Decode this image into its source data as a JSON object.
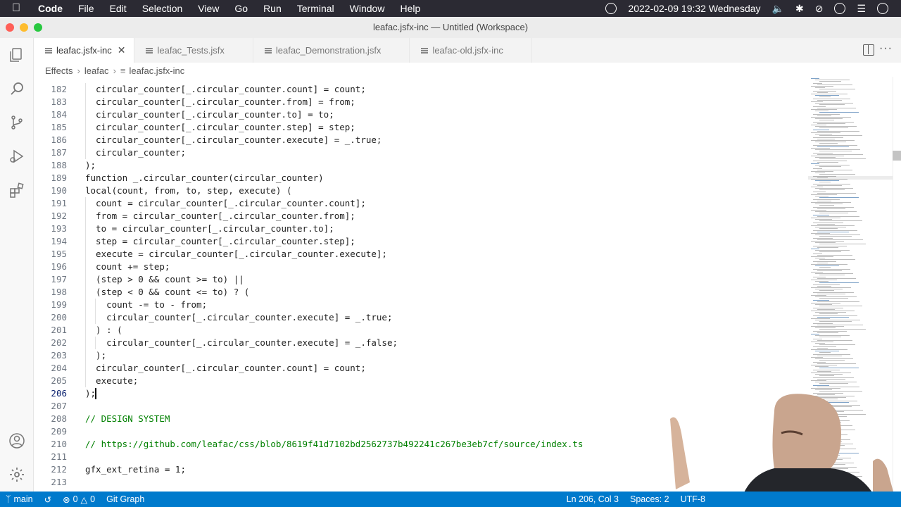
{
  "menubar": {
    "app_name": "Code",
    "items": [
      "File",
      "Edit",
      "Selection",
      "View",
      "Go",
      "Run",
      "Terminal",
      "Window",
      "Help"
    ],
    "clock": "2022-02-09  19:32  Wednesday"
  },
  "window": {
    "title": "leafac.jsfx-inc — Untitled (Workspace)"
  },
  "tabs": [
    {
      "label": "leafac.jsfx-inc",
      "active": true
    },
    {
      "label": "leafac_Tests.jsfx"
    },
    {
      "label": "leafac_Demonstration.jsfx"
    },
    {
      "label": "leafac-old.jsfx-inc"
    }
  ],
  "breadcrumb": [
    "Effects",
    "leafac",
    "leafac.jsfx-inc"
  ],
  "editor": {
    "current_line": "206",
    "lines": [
      {
        "n": "182",
        "t": "  circular_counter[_.circular_counter.count] = count;"
      },
      {
        "n": "183",
        "t": "  circular_counter[_.circular_counter.from] = from;"
      },
      {
        "n": "184",
        "t": "  circular_counter[_.circular_counter.to] = to;"
      },
      {
        "n": "185",
        "t": "  circular_counter[_.circular_counter.step] = step;"
      },
      {
        "n": "186",
        "t": "  circular_counter[_.circular_counter.execute] = _.true;"
      },
      {
        "n": "187",
        "t": "  circular_counter;"
      },
      {
        "n": "188",
        "t": ");"
      },
      {
        "n": "189",
        "t": "function _.circular_counter(circular_counter)"
      },
      {
        "n": "190",
        "t": "local(count, from, to, step, execute) ("
      },
      {
        "n": "191",
        "t": "  count = circular_counter[_.circular_counter.count];"
      },
      {
        "n": "192",
        "t": "  from = circular_counter[_.circular_counter.from];"
      },
      {
        "n": "193",
        "t": "  to = circular_counter[_.circular_counter.to];"
      },
      {
        "n": "194",
        "t": "  step = circular_counter[_.circular_counter.step];"
      },
      {
        "n": "195",
        "t": "  execute = circular_counter[_.circular_counter.execute];"
      },
      {
        "n": "196",
        "t": "  count += step;"
      },
      {
        "n": "197",
        "t": "  (step > 0 && count >= to) ||"
      },
      {
        "n": "198",
        "t": "  (step < 0 && count <= to) ? ("
      },
      {
        "n": "199",
        "t": "    count -= to - from;"
      },
      {
        "n": "200",
        "t": "    circular_counter[_.circular_counter.execute] = _.true;"
      },
      {
        "n": "201",
        "t": "  ) : ("
      },
      {
        "n": "202",
        "t": "    circular_counter[_.circular_counter.execute] = _.false;"
      },
      {
        "n": "203",
        "t": "  );"
      },
      {
        "n": "204",
        "t": "  circular_counter[_.circular_counter.count] = count;"
      },
      {
        "n": "205",
        "t": "  execute;"
      },
      {
        "n": "206",
        "t": ");"
      },
      {
        "n": "207",
        "t": ""
      },
      {
        "n": "208",
        "t": "// DESIGN SYSTEM"
      },
      {
        "n": "209",
        "t": ""
      },
      {
        "n": "210",
        "t": "// https://github.com/leafac/css/blob/8619f41d7102bd2562737b492241c267be3eb7cf/source/index.ts"
      },
      {
        "n": "211",
        "t": ""
      },
      {
        "n": "212",
        "t": "gfx_ext_retina = 1;"
      },
      {
        "n": "213",
        "t": ""
      }
    ]
  },
  "statusbar": {
    "branch": "main",
    "errors": "0",
    "warnings": "0",
    "git_graph": "Git Graph",
    "position": "Ln 206, Col 3",
    "spaces": "Spaces: 2",
    "encoding": "UTF-8"
  },
  "colors": {
    "statusbar": "#007acc",
    "keyword": "#0000ff",
    "comment": "#008000"
  }
}
